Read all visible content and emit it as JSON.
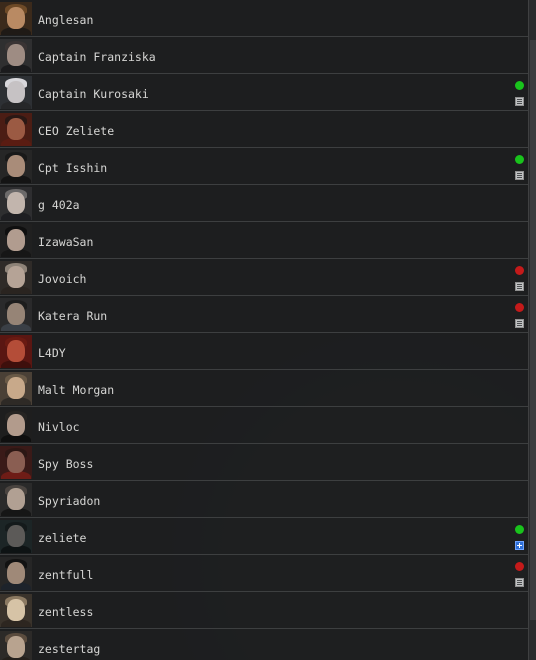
{
  "contacts": [
    {
      "name": "Anglesan",
      "status": null,
      "icon": null,
      "avatar": {
        "bg": "#3b2a1b",
        "skin": "#b98a63",
        "hair": "#6e4a27",
        "body": "#1f1a16"
      }
    },
    {
      "name": "Captain Franziska",
      "status": null,
      "icon": null,
      "avatar": {
        "bg": "#2f2f30",
        "skin": "#9e8c83",
        "hair": "#3a3434",
        "body": "#1b1b1d"
      }
    },
    {
      "name": "Captain Kurosaki",
      "status": "online",
      "icon": "note-icon",
      "avatar": {
        "bg": "#2d3034",
        "skin": "#c6c2c4",
        "hair": "#d8d7db",
        "body": "#262729"
      }
    },
    {
      "name": "CEO Zeliete",
      "status": null,
      "icon": null,
      "avatar": {
        "bg": "#4b1d14",
        "skin": "#9b5a43",
        "hair": "#2a1814",
        "body": "#5a1c12"
      }
    },
    {
      "name": "Cpt Isshin",
      "status": "online",
      "icon": "note-icon",
      "avatar": {
        "bg": "#262626",
        "skin": "#a98c79",
        "hair": "#191919",
        "body": "#141414"
      }
    },
    {
      "name": "g 402a",
      "status": null,
      "icon": null,
      "avatar": {
        "bg": "#2e2e30",
        "skin": "#c2b5ad",
        "hair": "#6c6a6a",
        "body": "#1e1e22"
      }
    },
    {
      "name": "IzawaSan",
      "status": null,
      "icon": null,
      "avatar": {
        "bg": "#202020",
        "skin": "#b19c8f",
        "hair": "#0f0f0f",
        "body": "#161616"
      }
    },
    {
      "name": "Jovoich",
      "status": "offline",
      "icon": "note-icon",
      "avatar": {
        "bg": "#2f2b28",
        "skin": "#b5a396",
        "hair": "#8e8378",
        "body": "#2a2420"
      }
    },
    {
      "name": "Katera Run",
      "status": "offline",
      "icon": "note-icon",
      "avatar": {
        "bg": "#2a2a2b",
        "skin": "#968476",
        "hair": "#1d1d1d",
        "body": "#3a3f46"
      }
    },
    {
      "name": "L4DY",
      "status": null,
      "icon": null,
      "avatar": {
        "bg": "#5a1612",
        "skin": "#b44d38",
        "hair": "#6a1a12",
        "body": "#3e0f0c"
      }
    },
    {
      "name": "Malt Morgan",
      "status": null,
      "icon": null,
      "avatar": {
        "bg": "#4a4036",
        "skin": "#c8a98a",
        "hair": "#6a5a47",
        "body": "#2e2a26"
      }
    },
    {
      "name": "Nivloc",
      "status": null,
      "icon": null,
      "avatar": {
        "bg": "#1e1e1e",
        "skin": "#b29b8c",
        "hair": "#262422",
        "body": "#0f0f0f"
      }
    },
    {
      "name": "Spy Boss",
      "status": null,
      "icon": null,
      "avatar": {
        "bg": "#3a1a18",
        "skin": "#8a5e52",
        "hair": "#2c1714",
        "body": "#6e1c16"
      }
    },
    {
      "name": "Spyriadon",
      "status": null,
      "icon": null,
      "avatar": {
        "bg": "#2a2a2a",
        "skin": "#b1a093",
        "hair": "#4a4440",
        "body": "#161616"
      }
    },
    {
      "name": "zeliete",
      "status": "online",
      "icon": "plus-icon",
      "avatar": {
        "bg": "#1c2526",
        "skin": "#5c5a58",
        "hair": "#141a1b",
        "body": "#0e1314"
      }
    },
    {
      "name": "zentfull",
      "status": "offline",
      "icon": "note-icon",
      "avatar": {
        "bg": "#262626",
        "skin": "#9f8978",
        "hair": "#121212",
        "body": "#1d232b"
      }
    },
    {
      "name": "zentless",
      "status": null,
      "icon": null,
      "avatar": {
        "bg": "#3a332b",
        "skin": "#d6c3a6",
        "hair": "#8c7a62",
        "body": "#2d2620"
      }
    },
    {
      "name": "zestertag",
      "status": null,
      "icon": null,
      "avatar": {
        "bg": "#2c2a28",
        "skin": "#b8a38f",
        "hair": "#5b4c3e",
        "body": "#24201c"
      }
    }
  ],
  "colors": {
    "online": "#19c31c",
    "offline": "#c41a1a",
    "row_border": "#3d3f40",
    "text": "#d6d6d4"
  }
}
